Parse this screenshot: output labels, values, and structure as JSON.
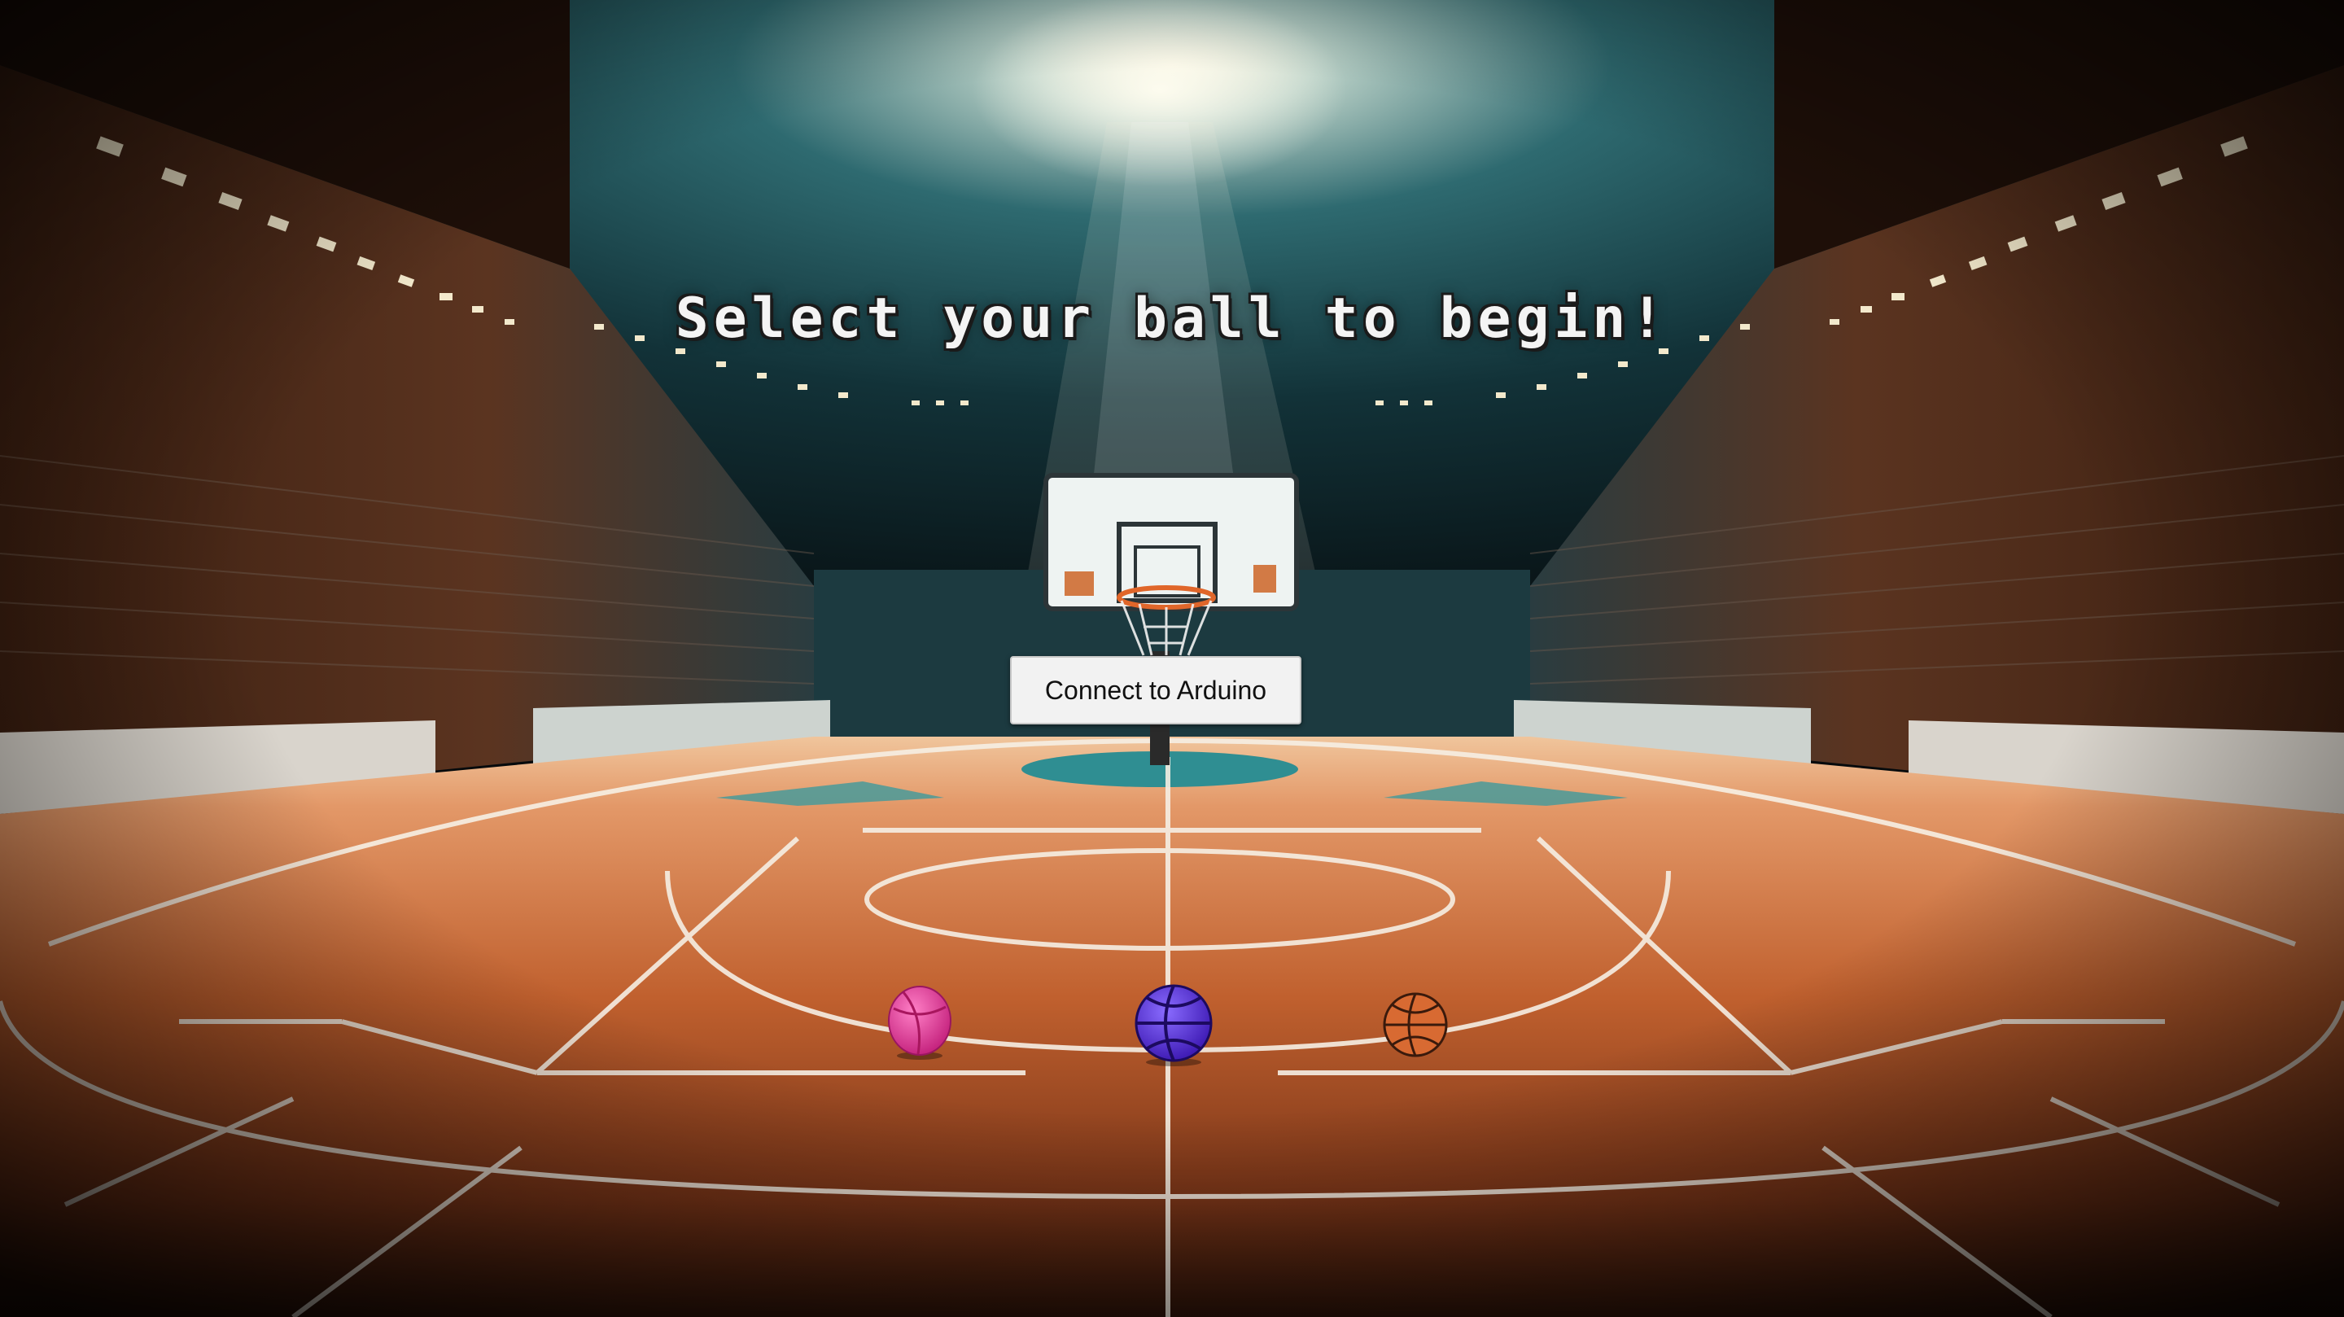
{
  "screen": {
    "title": "Select your ball to begin!",
    "connect_label": "Connect to Arduino"
  },
  "balls": [
    {
      "name": "pink-ball",
      "color": "#e8399a"
    },
    {
      "name": "purple-ball",
      "color": "#5b2fe0"
    },
    {
      "name": "classic-ball",
      "color": "#d86a32"
    }
  ],
  "palette": {
    "court": "#b8542a",
    "court_light": "#e8a070",
    "lines": "#f6efe4",
    "key_teal": "#2f8e92",
    "sky": "#12343c"
  }
}
